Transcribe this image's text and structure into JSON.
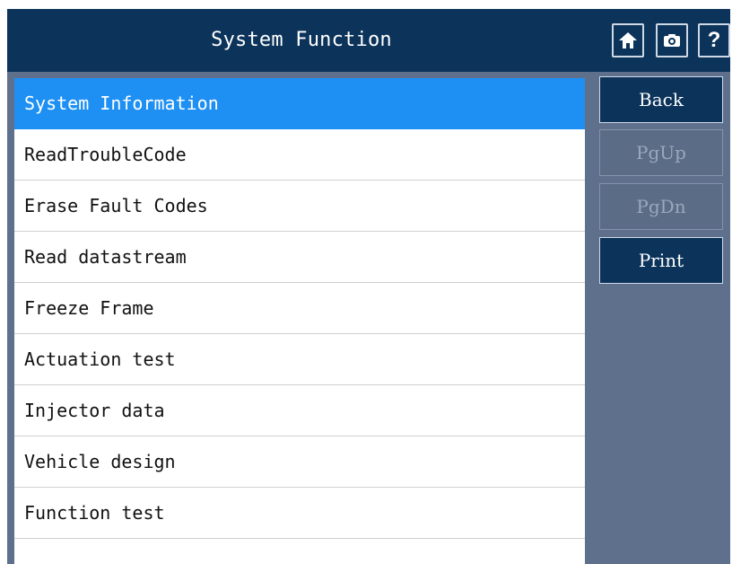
{
  "header": {
    "title": "System Function",
    "icons": [
      "home-icon",
      "camera-icon",
      "help-icon"
    ],
    "help_glyph": "?"
  },
  "menu": {
    "items": [
      {
        "label": "System Information",
        "selected": true
      },
      {
        "label": "ReadTroubleCode"
      },
      {
        "label": "Erase Fault Codes"
      },
      {
        "label": "Read datastream"
      },
      {
        "label": "Freeze Frame"
      },
      {
        "label": "Actuation test"
      },
      {
        "label": "Injector data"
      },
      {
        "label": "Vehicle design"
      },
      {
        "label": "Function test"
      }
    ]
  },
  "side": {
    "back": "Back",
    "pgup": "PgUp",
    "pgdn": "PgDn",
    "print": "Print"
  },
  "colors": {
    "header_bg": "#0c335a",
    "panel_bg": "#5f708d",
    "selected_bg": "#1e90f3",
    "button_disabled_bg": "#5b6c86"
  }
}
